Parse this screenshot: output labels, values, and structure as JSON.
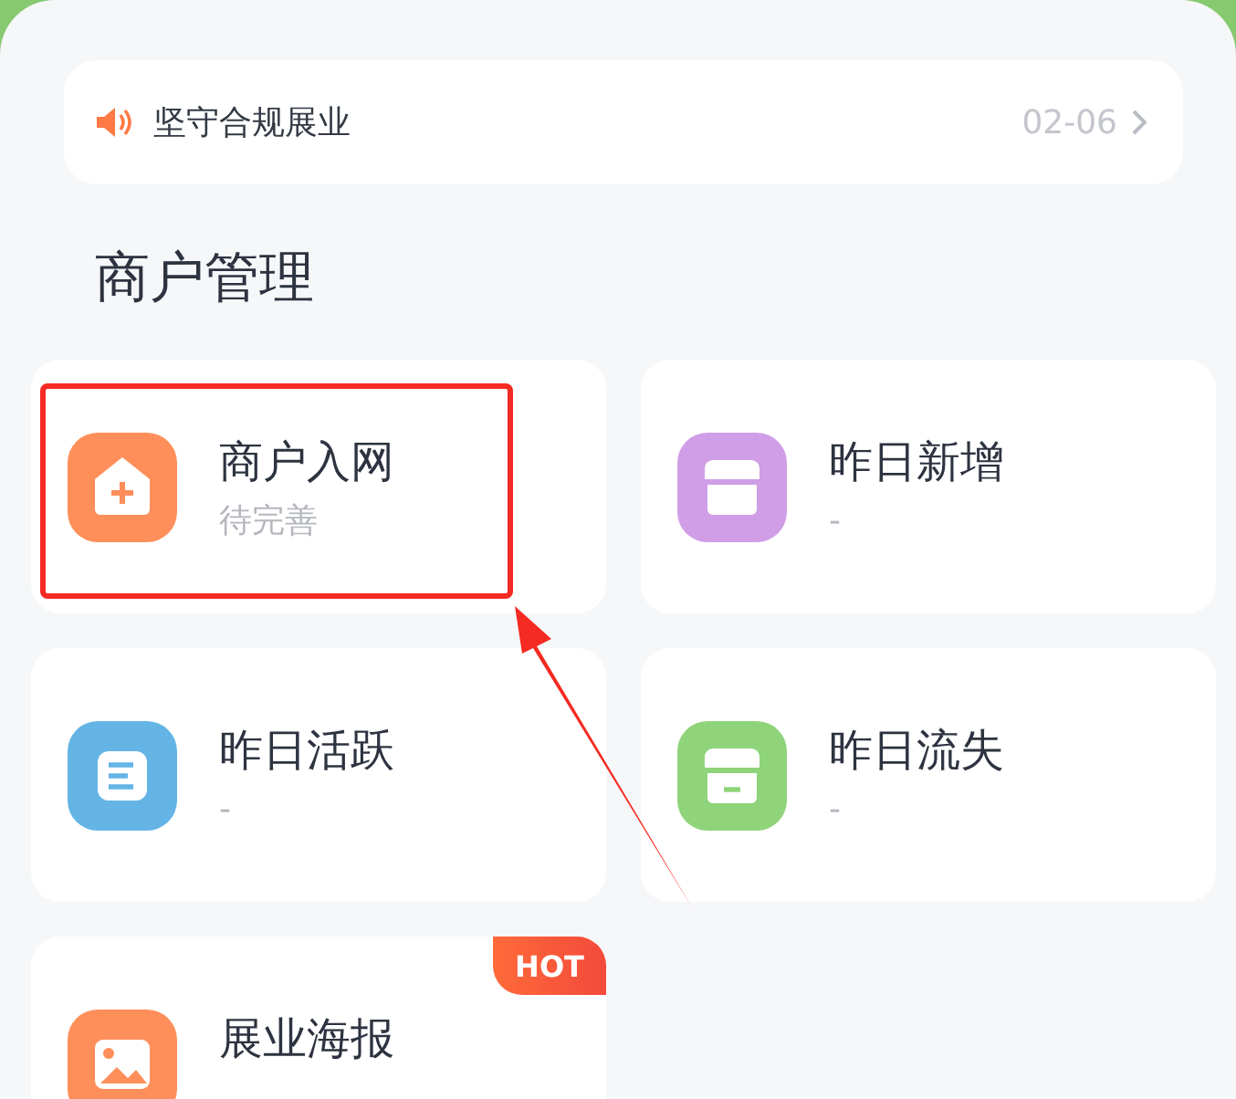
{
  "notice": {
    "text": "坚守合规展业",
    "date": "02-06"
  },
  "section_title": "商户管理",
  "cards": [
    {
      "title": "商户入网",
      "subtitle": "待完善",
      "color": "#ff8f5a",
      "highlighted": true
    },
    {
      "title": "昨日新增",
      "subtitle": "-",
      "color": "#cf9ee6",
      "highlighted": false
    },
    {
      "title": "昨日活跃",
      "subtitle": "-",
      "color": "#64b5e6",
      "highlighted": false
    },
    {
      "title": "昨日流失",
      "subtitle": "-",
      "color": "#8fd47a",
      "highlighted": false
    },
    {
      "title": "展业海报",
      "badge": "HOT",
      "color": "#ff8f5a",
      "highlighted": false
    }
  ]
}
